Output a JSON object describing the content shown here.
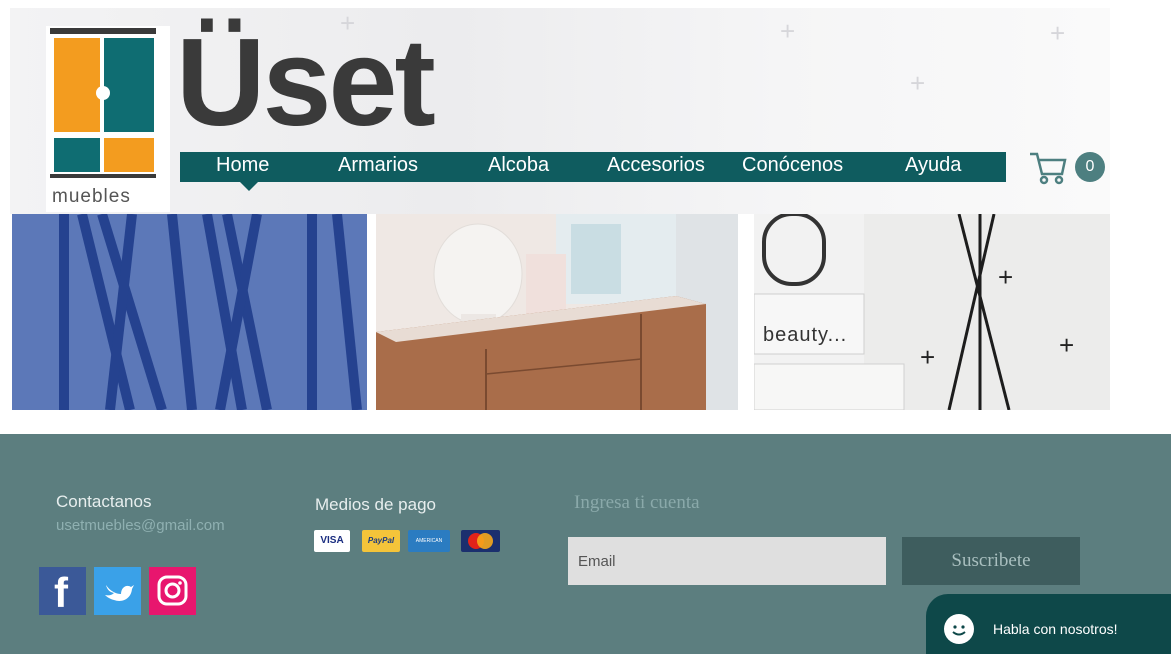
{
  "brand": {
    "name": "Üset",
    "logo_caption": "muebles"
  },
  "nav": {
    "items": [
      {
        "label": "Home"
      },
      {
        "label": "Armarios"
      },
      {
        "label": "Alcoba"
      },
      {
        "label": "Accesorios"
      },
      {
        "label": "Conócenos"
      },
      {
        "label": "Ayuda"
      }
    ],
    "active": "Home"
  },
  "cart": {
    "count": "0",
    "icon": "cart-icon"
  },
  "banners": {
    "b3_caption": "beauty..."
  },
  "footer": {
    "contact_title": "Contactanos",
    "contact_email": "usetmuebles@gmail.com",
    "payment_title": "Medios de pago",
    "payment_methods": [
      "VISA",
      "PayPal",
      "AMERICAN EXPRESS",
      "MasterCard"
    ],
    "account_title": "Ingresa ti cuenta",
    "email_placeholder": "Email",
    "subscribe_label": "Suscribete"
  },
  "chat": {
    "label": "Habla con nosotros!"
  },
  "colors": {
    "nav": "#0f5c5f",
    "footer": "#5c7e7f",
    "logo_orange": "#f39c1f",
    "logo_teal": "#0f6d72",
    "chat": "#0e4849"
  }
}
